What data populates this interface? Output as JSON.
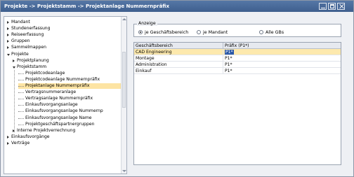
{
  "window": {
    "title": "Projekte -> Projektstamm -> Projektanlage Nummernpräfix"
  },
  "tree": {
    "items": [
      {
        "label": "Mandant",
        "level": 0,
        "state": "closed"
      },
      {
        "label": "Stundenerfassung",
        "level": 0,
        "state": "closed"
      },
      {
        "label": "Reiseerfassung",
        "level": 0,
        "state": "closed"
      },
      {
        "label": "Gruppen",
        "level": 0,
        "state": "closed"
      },
      {
        "label": "Sammelmappen",
        "level": 0,
        "state": "closed"
      },
      {
        "label": "Projekte",
        "level": 0,
        "state": "open"
      },
      {
        "label": "Projektplanung",
        "level": 1,
        "state": "closed"
      },
      {
        "label": "Projektstamm",
        "level": 1,
        "state": "open"
      },
      {
        "label": "Projektcodeanlage",
        "level": 2,
        "state": "leaf"
      },
      {
        "label": "Projektcodeanlage Nummernpräfix",
        "level": 2,
        "state": "leaf"
      },
      {
        "label": "Projektanlage Nummernpräfix",
        "level": 2,
        "state": "leaf",
        "selected": true
      },
      {
        "label": "Vertragsnummeranlage",
        "level": 2,
        "state": "leaf"
      },
      {
        "label": "Vertragsanlage Nummernpräfix",
        "level": 2,
        "state": "leaf"
      },
      {
        "label": "Einkaufsvorgangsanlage",
        "level": 2,
        "state": "leaf"
      },
      {
        "label": "Einkaufsvorgangsanlage Nummernp",
        "level": 2,
        "state": "leaf"
      },
      {
        "label": "Einkaufsvorgangsanlage Name",
        "level": 2,
        "state": "leaf"
      },
      {
        "label": "Projektgeschäftspartnergruppen",
        "level": 2,
        "state": "leaf"
      },
      {
        "label": "Interne Projektverrechnung",
        "level": 1,
        "state": "closed"
      },
      {
        "label": "Einkaufsvorgänge",
        "level": 0,
        "state": "closed"
      },
      {
        "label": "Verträge",
        "level": 0,
        "state": "closed"
      }
    ]
  },
  "display": {
    "group_label": "Anzeige",
    "options": [
      {
        "label": "je Geschäftsbereich",
        "checked": true
      },
      {
        "label": "je Mandant",
        "checked": false
      },
      {
        "label": "Alle GBs",
        "checked": false
      }
    ]
  },
  "grid": {
    "columns": [
      "Geschäftsbereich",
      "Präfix (P1*)"
    ],
    "rows": [
      {
        "bereich": "CAD Engineering",
        "praefix": "P1*",
        "active": true
      },
      {
        "bereich": "Montage",
        "praefix": "P1*",
        "active": false
      },
      {
        "bereich": "Administration",
        "praefix": "P1*",
        "active": false
      },
      {
        "bereich": "Einkauf",
        "praefix": "P1*",
        "active": false
      }
    ]
  },
  "colors": {
    "title_bar": "#4a6a9a",
    "selection": "#fde4a3",
    "cell_highlight": "#2a57a6"
  }
}
